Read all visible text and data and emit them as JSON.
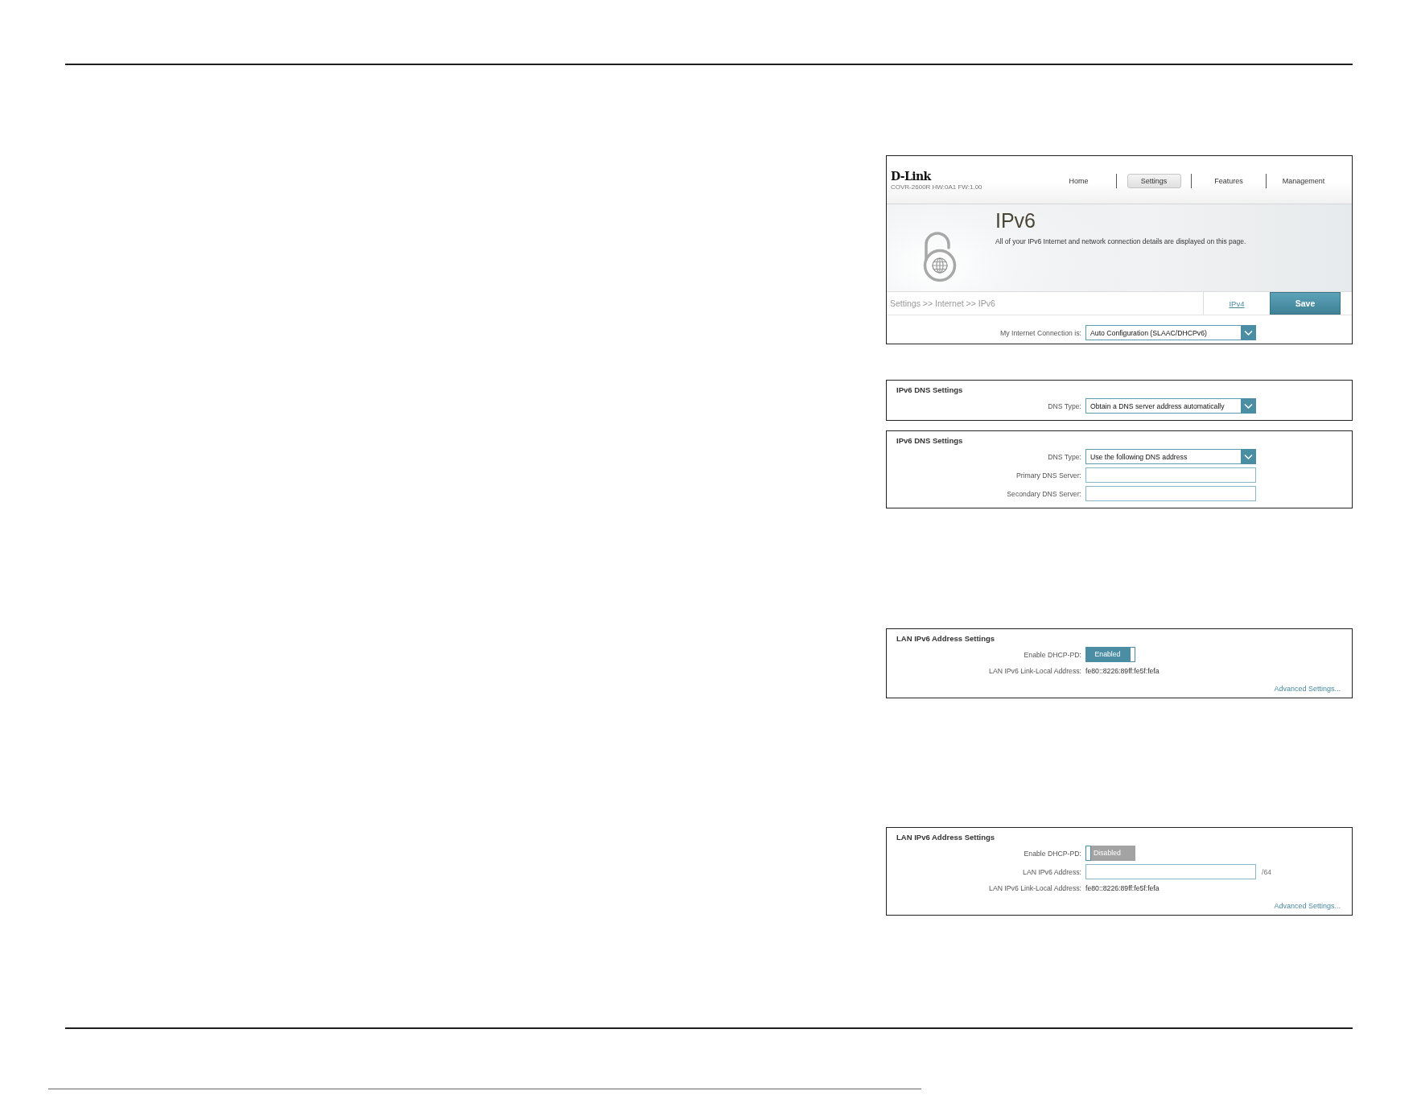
{
  "panels": [
    {
      "kind": "router_page",
      "logo": "D-Link",
      "model": "COVR-2600R HW:0A1 FW:1.00",
      "nav": [
        {
          "label": "Home",
          "selected": false
        },
        {
          "label": "Settings",
          "selected": true
        },
        {
          "label": "Features",
          "selected": false
        },
        {
          "label": "Management",
          "selected": false
        }
      ],
      "title": "IPv6",
      "description": "All of your IPv6 Internet and network connection details are displayed on this page.",
      "breadcrumb": "Settings >> Internet >> IPv6",
      "ipv4_link": "IPv4",
      "save": "Save",
      "fields": [
        {
          "kind": "select",
          "label": "My Internet Connection is:",
          "value": "Auto Configuration (SLAAC/DHCPv6)"
        }
      ]
    },
    {
      "kind": "section",
      "title": "IPv6 DNS Settings",
      "fields": [
        {
          "kind": "select",
          "label": "DNS Type:",
          "value": "Obtain a DNS server address automatically"
        }
      ]
    },
    {
      "kind": "section",
      "title": "IPv6 DNS Settings",
      "fields": [
        {
          "kind": "select",
          "label": "DNS Type:",
          "value": "Use the following DNS address"
        },
        {
          "kind": "input",
          "label": "Primary DNS Server:"
        },
        {
          "kind": "input",
          "label": "Secondary DNS Server:"
        }
      ]
    },
    {
      "kind": "section",
      "title": "LAN IPv6 Address Settings",
      "fields": [
        {
          "kind": "toggle",
          "label": "Enable DHCP-PD:",
          "on": true,
          "text": "Enabled"
        },
        {
          "kind": "text",
          "label": "LAN IPv6 Link-Local Address:",
          "value": "fe80::8226:89ff:fe5f:fefa"
        }
      ],
      "advanced_link": "Advanced Settings..."
    },
    {
      "kind": "section",
      "title": "LAN IPv6 Address Settings",
      "fields": [
        {
          "kind": "toggle",
          "label": "Enable DHCP-PD:",
          "on": false,
          "text": "Disabled"
        },
        {
          "kind": "input",
          "label": "LAN IPv6 Address:",
          "suffix": "/64"
        },
        {
          "kind": "text",
          "label": "LAN IPv6 Link-Local Address:",
          "value": "fe80::8226:89ff:fe5f:fefa"
        }
      ],
      "advanced_link": "Advanced Settings..."
    }
  ]
}
